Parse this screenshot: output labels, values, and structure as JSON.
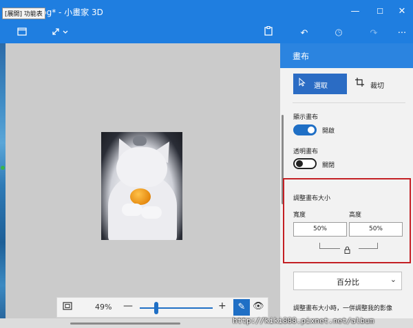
{
  "window": {
    "tooltip": "[展開] 功能表",
    "title": "pg* - 小畫家 3D",
    "minimize_icon": "minimize-icon",
    "maximize_icon": "maximize-icon",
    "close_icon": "close-icon"
  },
  "toolbar": {
    "items": [
      "menu-icon",
      "expand-icon",
      "paste-icon",
      "undo-icon",
      "history-icon",
      "redo-icon",
      "more-icon"
    ]
  },
  "canvas": {
    "image_subject": "white cat holding orange"
  },
  "zoombar": {
    "zoom_percent": "49%",
    "minus": "—",
    "plus": "+"
  },
  "panel": {
    "title": "畫布",
    "select_label": "選取",
    "crop_label": "裁切",
    "show_canvas_label": "顯示畫布",
    "show_canvas_state": "開啟",
    "transparent_canvas_label": "透明畫布",
    "transparent_canvas_state": "關閉",
    "resize_title": "調整畫布大小",
    "width_label": "寬度",
    "height_label": "高度",
    "width_value": "50%",
    "height_value": "50%",
    "unit_value": "百分比",
    "note": "調整畫布大小時，一併調整我的影像"
  },
  "watermark": "http://kiki888.pixnet.net/album"
}
